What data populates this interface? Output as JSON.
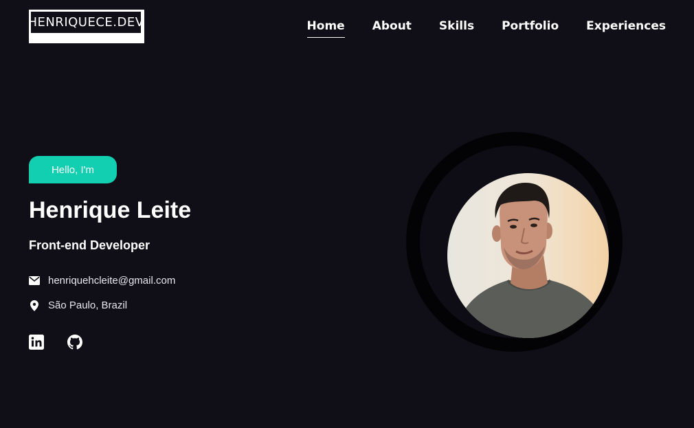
{
  "header": {
    "logo_text": "HENRIQUECE.DEV",
    "nav": [
      {
        "label": "Home",
        "active": true
      },
      {
        "label": "About"
      },
      {
        "label": "Skills"
      },
      {
        "label": "Portfolio"
      },
      {
        "label": "Experiences"
      }
    ]
  },
  "hero": {
    "greeting": "Hello, I'm",
    "name": "Henrique Leite",
    "role": "Front-end Developer",
    "email": "henriquehcleite@gmail.com",
    "location": "São Paulo, Brazil",
    "icons": {
      "email": "envelope-icon",
      "location": "map-pin-icon",
      "linkedin": "linkedin-icon",
      "github": "github-icon"
    }
  },
  "colors": {
    "background": "#100f18",
    "accent": "#11cfb0",
    "text": "#ffffff"
  }
}
